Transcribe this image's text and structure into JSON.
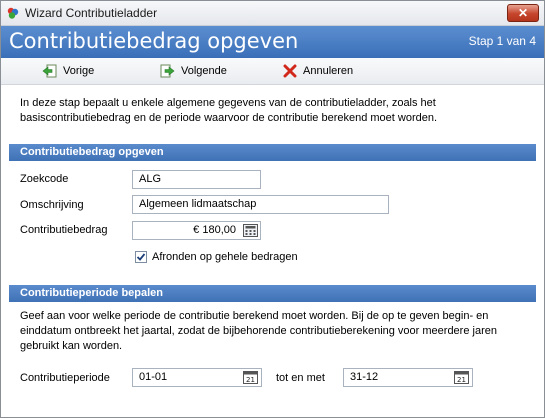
{
  "window": {
    "title": "Wizard Contributieladder",
    "close_label": "✕"
  },
  "header": {
    "title": "Contributiebedrag opgeven",
    "step": "Stap 1 van 4"
  },
  "toolbar": {
    "prev_label": "Vorige",
    "next_label": "Volgende",
    "cancel_label": "Annuleren"
  },
  "intro": "In deze stap bepaalt u enkele algemene gegevens van de contributieladder, zoals het basiscontributiebedrag en de periode waarvoor de contributie berekend moet worden.",
  "section1": {
    "title": "Contributiebedrag opgeven",
    "zoekcode_label": "Zoekcode",
    "zoekcode_value": "ALG",
    "omschrijving_label": "Omschrijving",
    "omschrijving_value": "Algemeen lidmaatschap",
    "bedrag_label": "Contributiebedrag",
    "bedrag_value": "€ 180,00",
    "afronden_label": "Afronden op gehele bedragen",
    "afronden_checked": true
  },
  "section2": {
    "title": "Contributieperiode bepalen",
    "description": "Geef aan voor welke periode de contributie berekend moet worden. Bij de op te geven begin- en einddatum ontbreekt het jaartal, zodat de bijbehorende contributieberekening voor meerdere jaren gebruikt kan worden.",
    "periode_label": "Contributieperiode",
    "start_value": "01-01",
    "tot_label": "tot en met",
    "end_value": "31-12"
  },
  "colors": {
    "header_blue": "#4a7ec4",
    "section_blue": "#4b7cc0"
  }
}
